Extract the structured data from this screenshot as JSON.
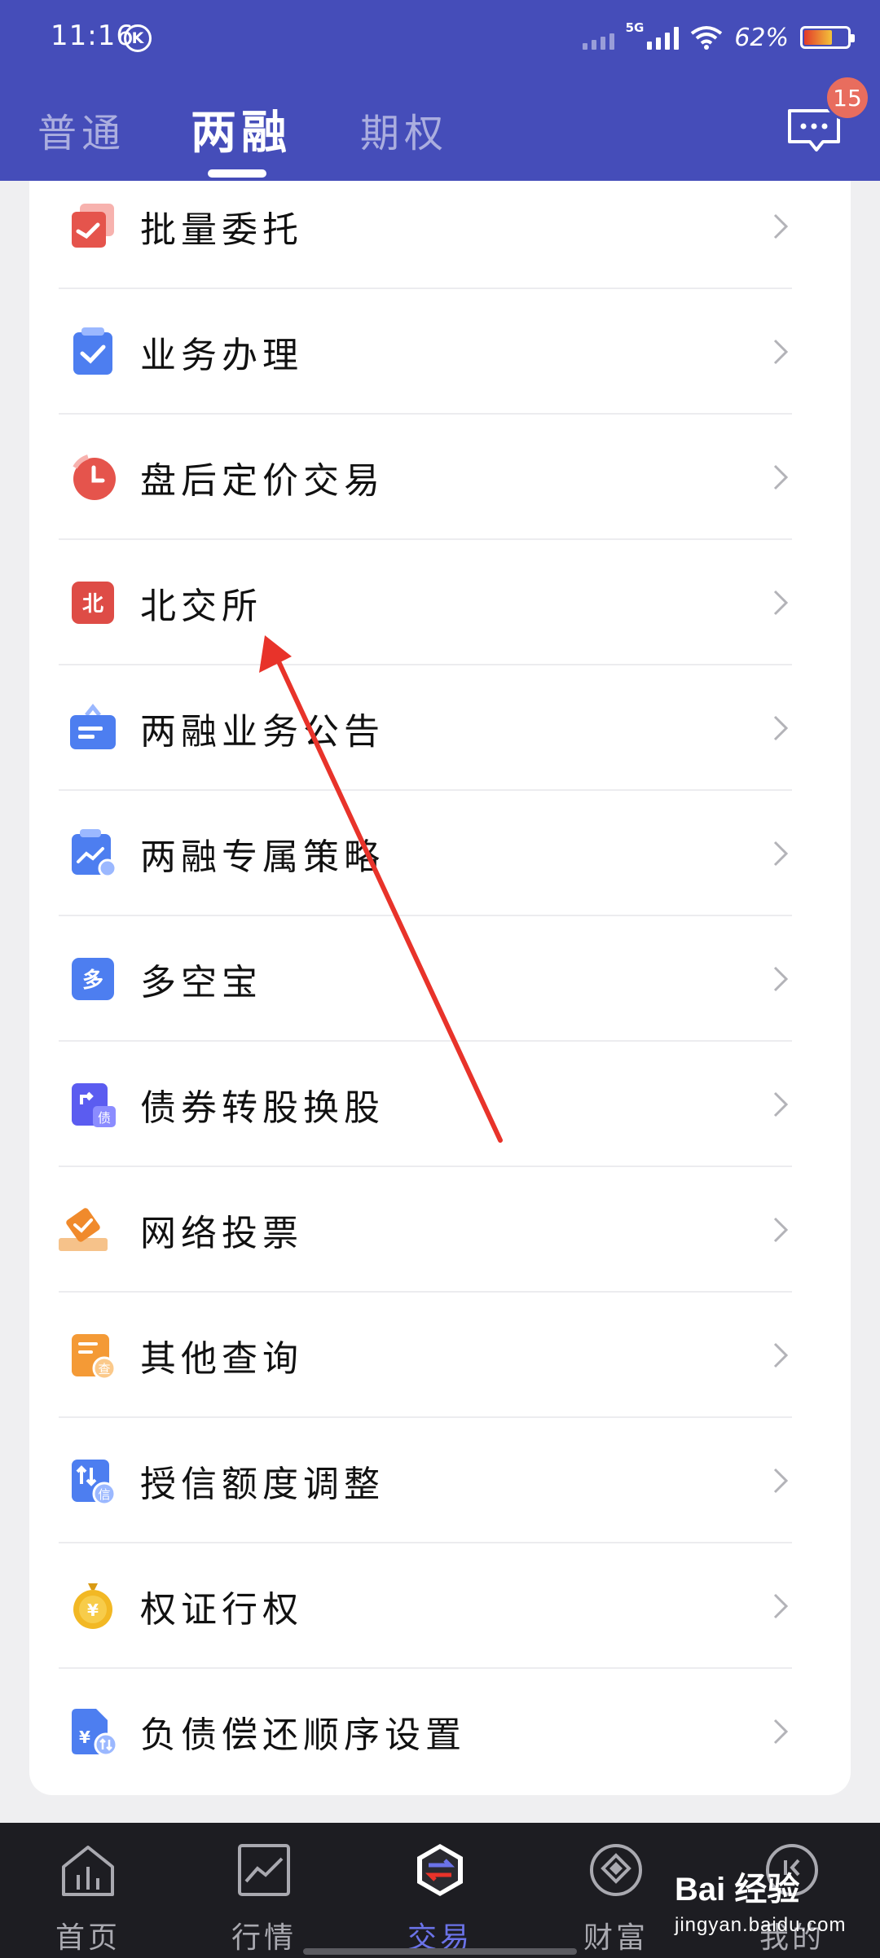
{
  "status_bar": {
    "time": "11:16",
    "k_badge": "K",
    "network": "5G",
    "battery_percent": "62%"
  },
  "tabs": [
    {
      "label": "普通",
      "active": false
    },
    {
      "label": "两融",
      "active": true
    },
    {
      "label": "期权",
      "active": false
    }
  ],
  "message_badge": "15",
  "menu_items": [
    {
      "label": "批量委托",
      "icon": "batch-order-icon"
    },
    {
      "label": "业务办理",
      "icon": "clipboard-check-icon"
    },
    {
      "label": "盘后定价交易",
      "icon": "clock-icon"
    },
    {
      "label": "北交所",
      "icon": "bse-icon"
    },
    {
      "label": "两融业务公告",
      "icon": "notice-board-icon"
    },
    {
      "label": "两融专属策略",
      "icon": "strategy-chart-icon"
    },
    {
      "label": "多空宝",
      "icon": "duokong-icon"
    },
    {
      "label": "债券转股换股",
      "icon": "bond-convert-icon"
    },
    {
      "label": "网络投票",
      "icon": "vote-icon"
    },
    {
      "label": "其他查询",
      "icon": "query-icon"
    },
    {
      "label": "授信额度调整",
      "icon": "credit-adjust-icon"
    },
    {
      "label": "权证行权",
      "icon": "warrant-coin-icon"
    },
    {
      "label": "负债偿还顺序设置",
      "icon": "repay-order-icon"
    }
  ],
  "icon_glyphs": {
    "bse": "北",
    "duokong": "多",
    "bond": "债",
    "query": "查",
    "credit": "信",
    "yen": "¥"
  },
  "bottom_nav": [
    {
      "label": "首页",
      "icon": "home-chart-icon",
      "active": false
    },
    {
      "label": "行情",
      "icon": "market-trend-icon",
      "active": false
    },
    {
      "label": "交易",
      "icon": "trade-exchange-icon",
      "active": true
    },
    {
      "label": "财富",
      "icon": "wealth-diamond-icon",
      "active": false
    },
    {
      "label": "我的",
      "icon": "profile-icon",
      "active": false
    }
  ],
  "watermark": {
    "brand": "Bai 经验",
    "url": "jingyan.baidu.com"
  },
  "colors": {
    "header": "#454db9",
    "accent": "#6b73e8",
    "arrow": "#e8332a"
  }
}
